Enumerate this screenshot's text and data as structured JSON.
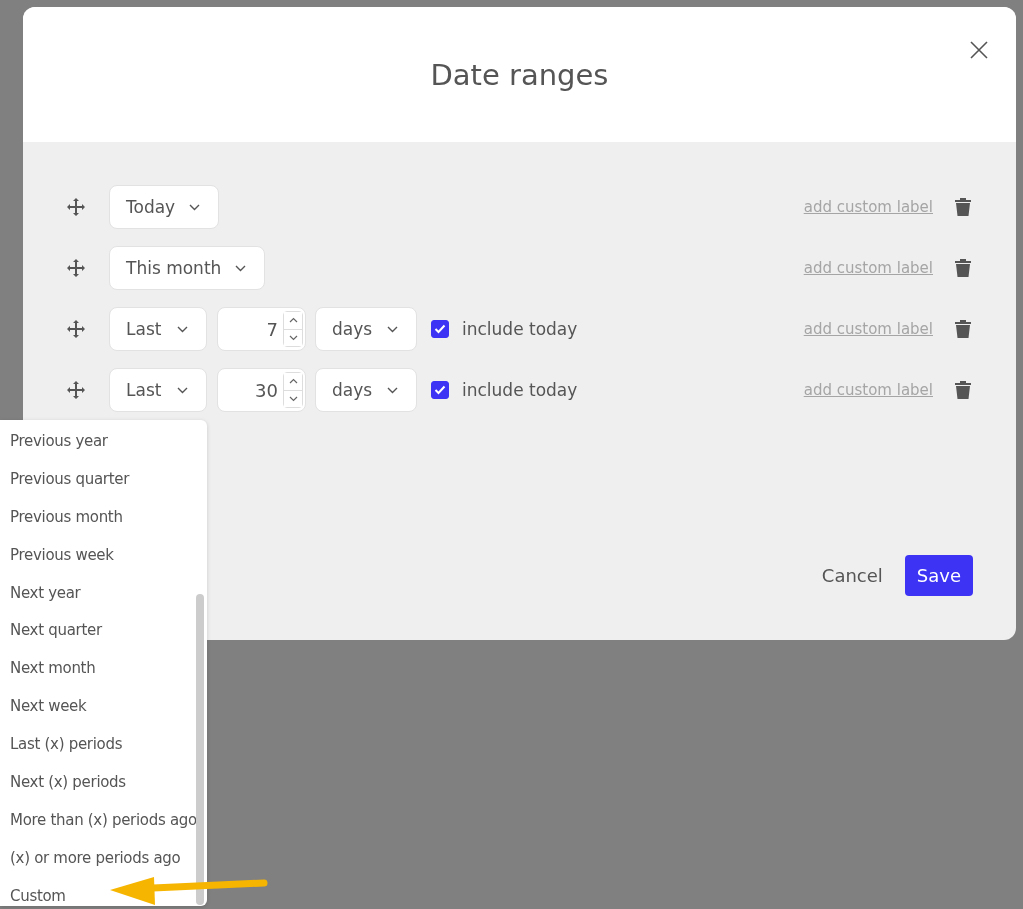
{
  "dialog": {
    "title": "Date ranges",
    "ranges": [
      {
        "kind": "preset",
        "preset": "Today",
        "custom_label_link": "add custom label"
      },
      {
        "kind": "preset",
        "preset": "This month",
        "custom_label_link": "add custom label"
      },
      {
        "kind": "relative",
        "direction": "Last",
        "count": "7",
        "unit": "days",
        "include_today": {
          "label": "include today",
          "checked": true
        },
        "custom_label_link": "add custom label"
      },
      {
        "kind": "relative",
        "direction": "Last",
        "count": "30",
        "unit": "days",
        "include_today": {
          "label": "include today",
          "checked": true
        },
        "custom_label_link": "add custom label"
      }
    ],
    "buttons": {
      "cancel": "Cancel",
      "save": "Save"
    }
  },
  "dropdown": {
    "items": [
      {
        "label": "Previous year",
        "selected": false
      },
      {
        "label": "Previous quarter",
        "selected": false
      },
      {
        "label": "Previous month",
        "selected": false
      },
      {
        "label": "Previous week",
        "selected": false
      },
      {
        "label": "Next year",
        "selected": false
      },
      {
        "label": "Next quarter",
        "selected": false
      },
      {
        "label": "Next month",
        "selected": false
      },
      {
        "label": "Next week",
        "selected": false
      },
      {
        "label": "Last (x) periods",
        "selected": false
      },
      {
        "label": "Next (x) periods",
        "selected": false
      },
      {
        "label": "More than (x) periods ago",
        "selected": false
      },
      {
        "label": "(x) or more periods ago",
        "selected": false
      },
      {
        "label": "Custom",
        "selected": false
      }
    ]
  }
}
